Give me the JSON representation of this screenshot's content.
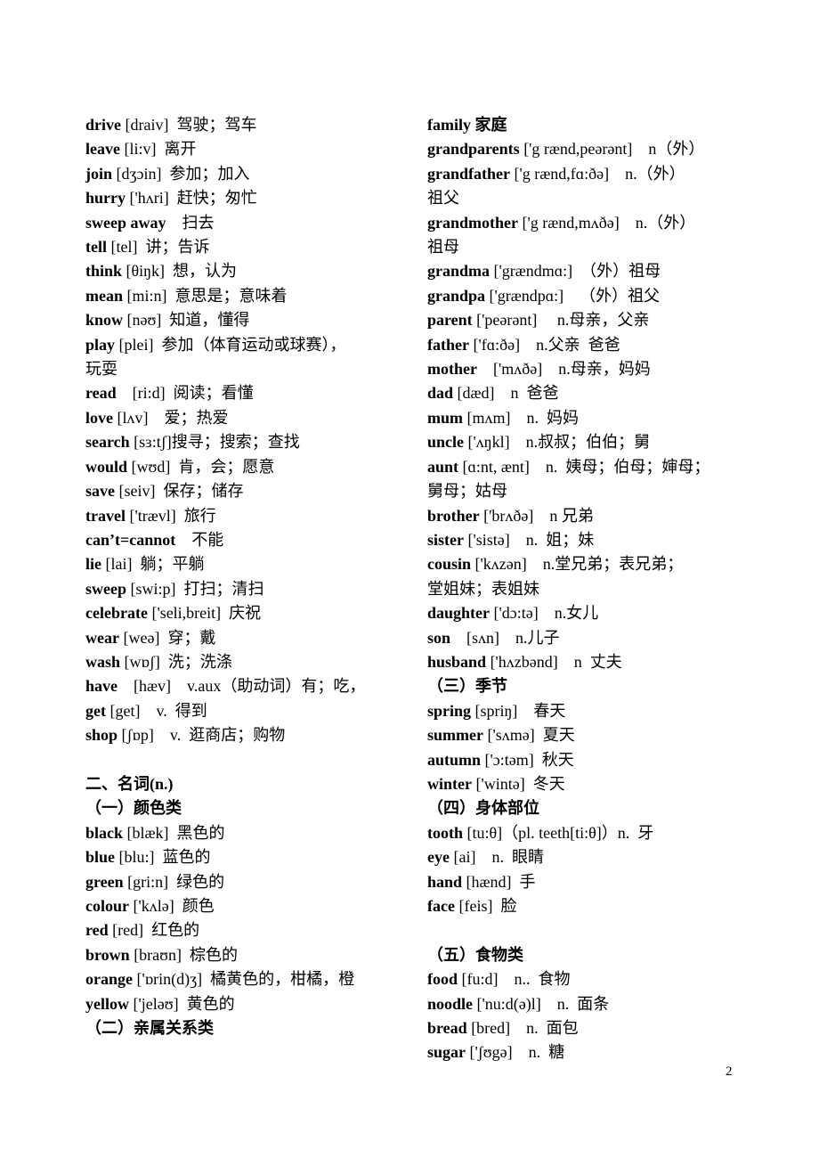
{
  "left_column": [
    {
      "type": "entry",
      "word": "drive",
      "rest": " [draiv]  驾驶；驾车"
    },
    {
      "type": "entry",
      "word": "leave",
      "rest": " [li:v]  离开"
    },
    {
      "type": "entry",
      "word": "join",
      "rest": " [dʒɔin]  参加；加入"
    },
    {
      "type": "entry",
      "word": "hurry",
      "rest": " ['hʌri]  赶快；匆忙"
    },
    {
      "type": "entry",
      "word": "sweep away",
      "rest": "    扫去"
    },
    {
      "type": "entry",
      "word": "tell",
      "rest": " [tel]  讲；告诉"
    },
    {
      "type": "entry",
      "word": "think",
      "rest": " [θiŋk]  想，认为"
    },
    {
      "type": "entry",
      "word": "mean",
      "rest": " [mi:n]  意思是；意味着"
    },
    {
      "type": "entry",
      "word": "know",
      "rest": " [nəʊ]  知道，懂得"
    },
    {
      "type": "entry",
      "word": "play",
      "rest": " [plei]  参加（体育运动或球赛），"
    },
    {
      "type": "text",
      "text": "玩耍"
    },
    {
      "type": "entry",
      "word": "read",
      "rest": "    [ri:d]  阅读；看懂"
    },
    {
      "type": "entry",
      "word": "love",
      "rest": " [lʌv]    爱；热爱"
    },
    {
      "type": "entry",
      "word": "search",
      "rest": " [sɜ:tʃ]搜寻；搜索；查找"
    },
    {
      "type": "entry",
      "word": "would",
      "rest": " [wʊd]  肯，会；愿意"
    },
    {
      "type": "entry",
      "word": "save",
      "rest": " [seiv]  保存；储存"
    },
    {
      "type": "entry",
      "word": "travel",
      "rest": " ['trævl]  旅行"
    },
    {
      "type": "entry",
      "word": "can’t=cannot",
      "rest": "    不能"
    },
    {
      "type": "entry",
      "word": "lie",
      "rest": " [lai]  躺；平躺"
    },
    {
      "type": "entry",
      "word": "sweep",
      "rest": " [swi:p]  打扫；清扫"
    },
    {
      "type": "entry",
      "word": "celebrate",
      "rest": " ['seli,breit]  庆祝"
    },
    {
      "type": "entry",
      "word": "wear",
      "rest": " [weə]  穿；戴"
    },
    {
      "type": "entry",
      "word": "wash",
      "rest": " [wɒʃ]  洗；洗涤"
    },
    {
      "type": "entry",
      "word": "have",
      "rest": "    [hæv]    v.aux（助动词）有；吃，"
    },
    {
      "type": "entry",
      "word": "get",
      "rest": " [get]    v.  得到"
    },
    {
      "type": "entry",
      "word": "shop",
      "rest": " [ʃɒp]    v.  逛商店；购物"
    },
    {
      "type": "blank"
    },
    {
      "type": "heading",
      "text": "二、名词(n.)"
    },
    {
      "type": "heading",
      "text": "（一）颜色类"
    },
    {
      "type": "entry",
      "word": "black",
      "rest": " [blæk]  黑色的"
    },
    {
      "type": "entry",
      "word": "blue",
      "rest": " [blu:]  蓝色的"
    },
    {
      "type": "entry",
      "word": "green",
      "rest": " [gri:n]  绿色的"
    },
    {
      "type": "entry",
      "word": "colour",
      "rest": " ['kʌlə]  颜色"
    },
    {
      "type": "entry",
      "word": "red",
      "rest": " [red]  红色的"
    },
    {
      "type": "entry",
      "word": "brown",
      "rest": " [braʊn]  棕色的"
    },
    {
      "type": "entry",
      "word": "orange",
      "rest": " ['ɒrin(d)ʒ]  橘黄色的，柑橘，橙"
    },
    {
      "type": "entry",
      "word": "yellow",
      "rest": " ['jeləʊ]  黄色的"
    },
    {
      "type": "heading",
      "text": "（二）亲属关系类"
    }
  ],
  "right_column": [
    {
      "type": "heading",
      "text": "family 家庭"
    },
    {
      "type": "entry",
      "word": "grandparents",
      "rest": " ['g rænd,peərənt]    n（外）"
    },
    {
      "type": "entry",
      "word": "grandfather",
      "rest": " ['g rænd,fɑ:ðə]    n.（外）"
    },
    {
      "type": "text",
      "text": "祖父"
    },
    {
      "type": "entry",
      "word": "grandmother",
      "rest": " ['g rænd,mʌðə]    n.（外）"
    },
    {
      "type": "text",
      "text": "祖母"
    },
    {
      "type": "entry",
      "word": "grandma",
      "rest": " ['grændmɑ:]  （外）祖母"
    },
    {
      "type": "entry",
      "word": "grandpa",
      "rest": " ['grændpɑ:]    （外）祖父"
    },
    {
      "type": "entry",
      "word": "parent",
      "rest": " ['peərənt]     n.母亲，父亲"
    },
    {
      "type": "entry",
      "word": "father",
      "rest": " ['fɑ:ðə]    n.父亲  爸爸"
    },
    {
      "type": "entry",
      "word": "mother",
      "rest": "    ['mʌðə]    n.母亲，妈妈"
    },
    {
      "type": "entry",
      "word": "dad",
      "rest": " [dæd]    n  爸爸"
    },
    {
      "type": "entry",
      "word": "mum",
      "rest": " [mʌm]    n.  妈妈"
    },
    {
      "type": "entry",
      "word": "uncle",
      "rest": " ['ʌŋkl]    n.叔叔；伯伯；舅"
    },
    {
      "type": "entry",
      "word": "aunt",
      "rest": " [ɑ:nt, ænt]    n.  姨母；伯母；婶母；"
    },
    {
      "type": "text",
      "text": "舅母；姑母"
    },
    {
      "type": "entry",
      "word": "brother",
      "rest": " ['brʌðə]    n 兄弟"
    },
    {
      "type": "entry",
      "word": "sister",
      "rest": " ['sistə]    n.  姐；妹"
    },
    {
      "type": "entry",
      "word": "cousin",
      "rest": " ['kʌzən]    n.堂兄弟；表兄弟；"
    },
    {
      "type": "text",
      "text": "堂姐妹；表姐妹"
    },
    {
      "type": "entry",
      "word": "daughter",
      "rest": " ['dɔ:tə]    n.女儿"
    },
    {
      "type": "entry",
      "word": "son",
      "rest": "    [sʌn]    n.儿子"
    },
    {
      "type": "entry",
      "word": "husband",
      "rest": " ['hʌzbənd]    n  丈夫"
    },
    {
      "type": "heading",
      "text": "（三）季节"
    },
    {
      "type": "entry",
      "word": "spring",
      "rest": " [spriŋ]    春天"
    },
    {
      "type": "entry",
      "word": "summer",
      "rest": " ['sʌmə]  夏天"
    },
    {
      "type": "entry",
      "word": "autumn",
      "rest": " ['ɔ:təm]  秋天"
    },
    {
      "type": "entry",
      "word": "winter",
      "rest": " ['wintə]  冬天"
    },
    {
      "type": "heading",
      "text": "（四）身体部位"
    },
    {
      "type": "entry",
      "word": "tooth",
      "rest": " [tu:θ]（pl. teeth[ti:θ]）n.  牙"
    },
    {
      "type": "entry",
      "word": "eye",
      "rest": " [ai]    n.  眼睛"
    },
    {
      "type": "entry",
      "word": "hand",
      "rest": " [hænd]  手"
    },
    {
      "type": "entry",
      "word": "face",
      "rest": " [feis]  脸"
    },
    {
      "type": "blank"
    },
    {
      "type": "heading",
      "text": "（五）食物类"
    },
    {
      "type": "entry",
      "word": "food",
      "rest": " [fu:d]    n..  食物"
    },
    {
      "type": "entry",
      "word": "noodle",
      "rest": " ['nu:d(ə)l]    n.  面条"
    },
    {
      "type": "entry",
      "word": "bread",
      "rest": " [bred]    n.  面包"
    },
    {
      "type": "entry",
      "word": "sugar",
      "rest": " ['ʃʊgə]    n.  糖"
    }
  ],
  "page_number": "2"
}
